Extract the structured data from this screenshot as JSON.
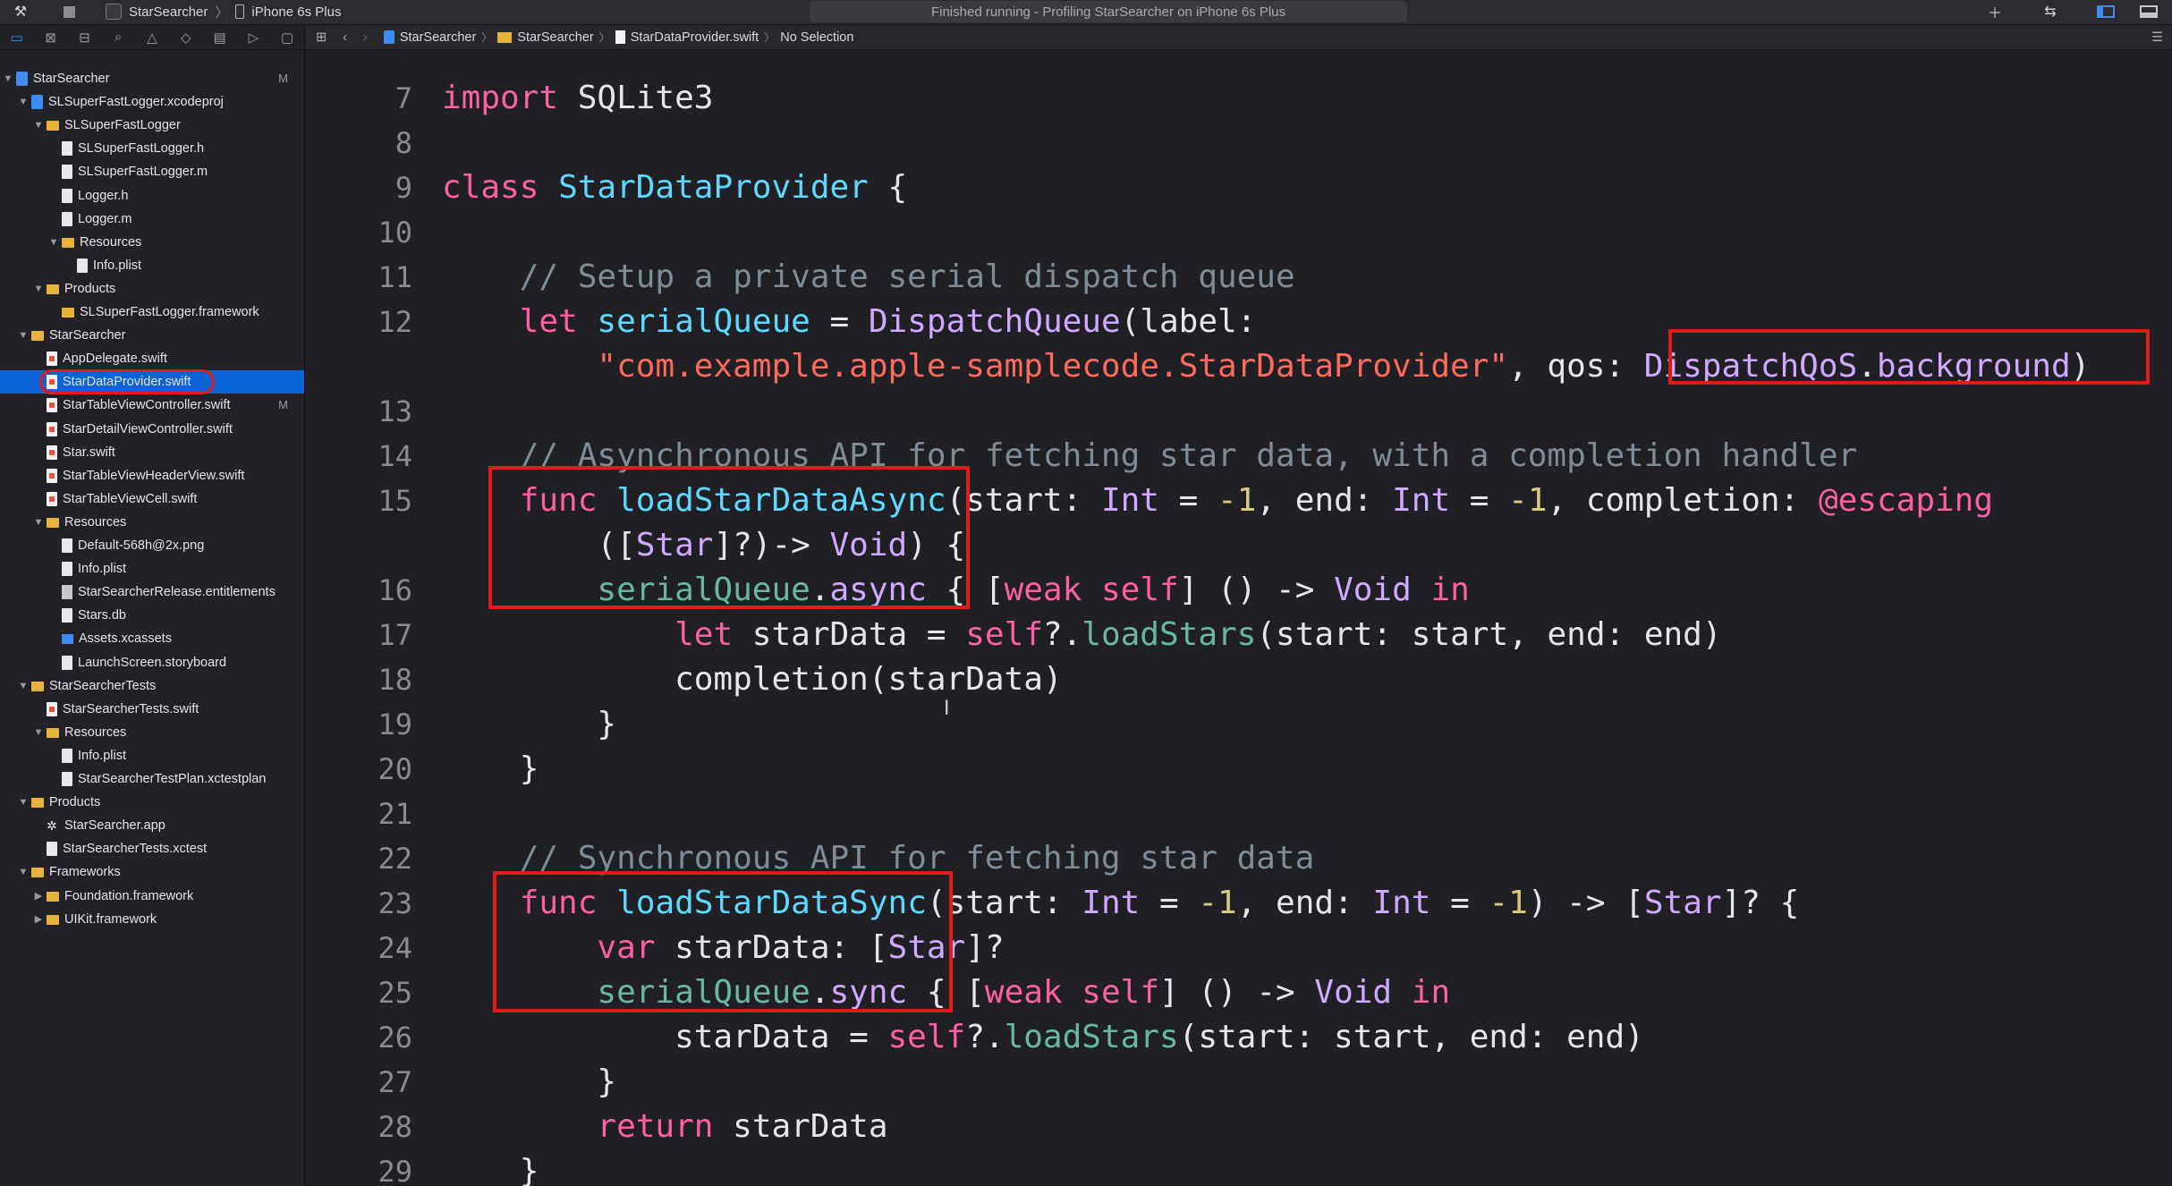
{
  "toolbar": {
    "scheme_app": "StarSearcher",
    "scheme_device": "iPhone 6s Plus",
    "activity_status": "Finished running - Profiling StarSearcher on iPhone 6s Plus"
  },
  "navigator": {
    "items": [
      {
        "label": "StarSearcher",
        "badge": "M"
      },
      {
        "label": "SLSuperFastLogger.xcodeproj"
      },
      {
        "label": "SLSuperFastLogger"
      },
      {
        "label": "SLSuperFastLogger.h"
      },
      {
        "label": "SLSuperFastLogger.m"
      },
      {
        "label": "Logger.h"
      },
      {
        "label": "Logger.m"
      },
      {
        "label": "Resources"
      },
      {
        "label": "Info.plist"
      },
      {
        "label": "Products"
      },
      {
        "label": "SLSuperFastLogger.framework"
      },
      {
        "label": "StarSearcher"
      },
      {
        "label": "AppDelegate.swift"
      },
      {
        "label": "StarDataProvider.swift"
      },
      {
        "label": "StarTableViewController.swift",
        "badge": "M"
      },
      {
        "label": "StarDetailViewController.swift"
      },
      {
        "label": "Star.swift"
      },
      {
        "label": "StarTableViewHeaderView.swift"
      },
      {
        "label": "StarTableViewCell.swift"
      },
      {
        "label": "Resources"
      },
      {
        "label": "Default-568h@2x.png"
      },
      {
        "label": "Info.plist"
      },
      {
        "label": "StarSearcherRelease.entitlements"
      },
      {
        "label": "Stars.db"
      },
      {
        "label": "Assets.xcassets"
      },
      {
        "label": "LaunchScreen.storyboard"
      },
      {
        "label": "StarSearcherTests"
      },
      {
        "label": "StarSearcherTests.swift"
      },
      {
        "label": "Resources"
      },
      {
        "label": "Info.plist"
      },
      {
        "label": "StarSearcherTestPlan.xctestplan"
      },
      {
        "label": "Products"
      },
      {
        "label": "StarSearcher.app"
      },
      {
        "label": "StarSearcherTests.xctest"
      },
      {
        "label": "Frameworks"
      },
      {
        "label": "Foundation.framework"
      },
      {
        "label": "UIKit.framework"
      }
    ]
  },
  "jumpbar": {
    "project": "StarSearcher",
    "group": "StarSearcher",
    "file": "StarDataProvider.swift",
    "selection": "No Selection"
  },
  "editor": {
    "line_numbers": [
      "7",
      "8",
      "9",
      "10",
      "11",
      "12",
      "13",
      "14",
      "15",
      "16",
      "17",
      "18",
      "19",
      "20",
      "21",
      "22",
      "23",
      "24",
      "25",
      "26",
      "27",
      "28",
      "29"
    ]
  },
  "colors": {
    "keyword": "#fc5fa3",
    "type": "#d0a8ff",
    "class_decl": "#5dd8ff",
    "function": "#67b7a4",
    "number": "#d9c97c",
    "string": "#fc6a5d",
    "comment": "#7f8c98",
    "annotation_box": "#e11a1a",
    "selection": "#0a64d6"
  }
}
